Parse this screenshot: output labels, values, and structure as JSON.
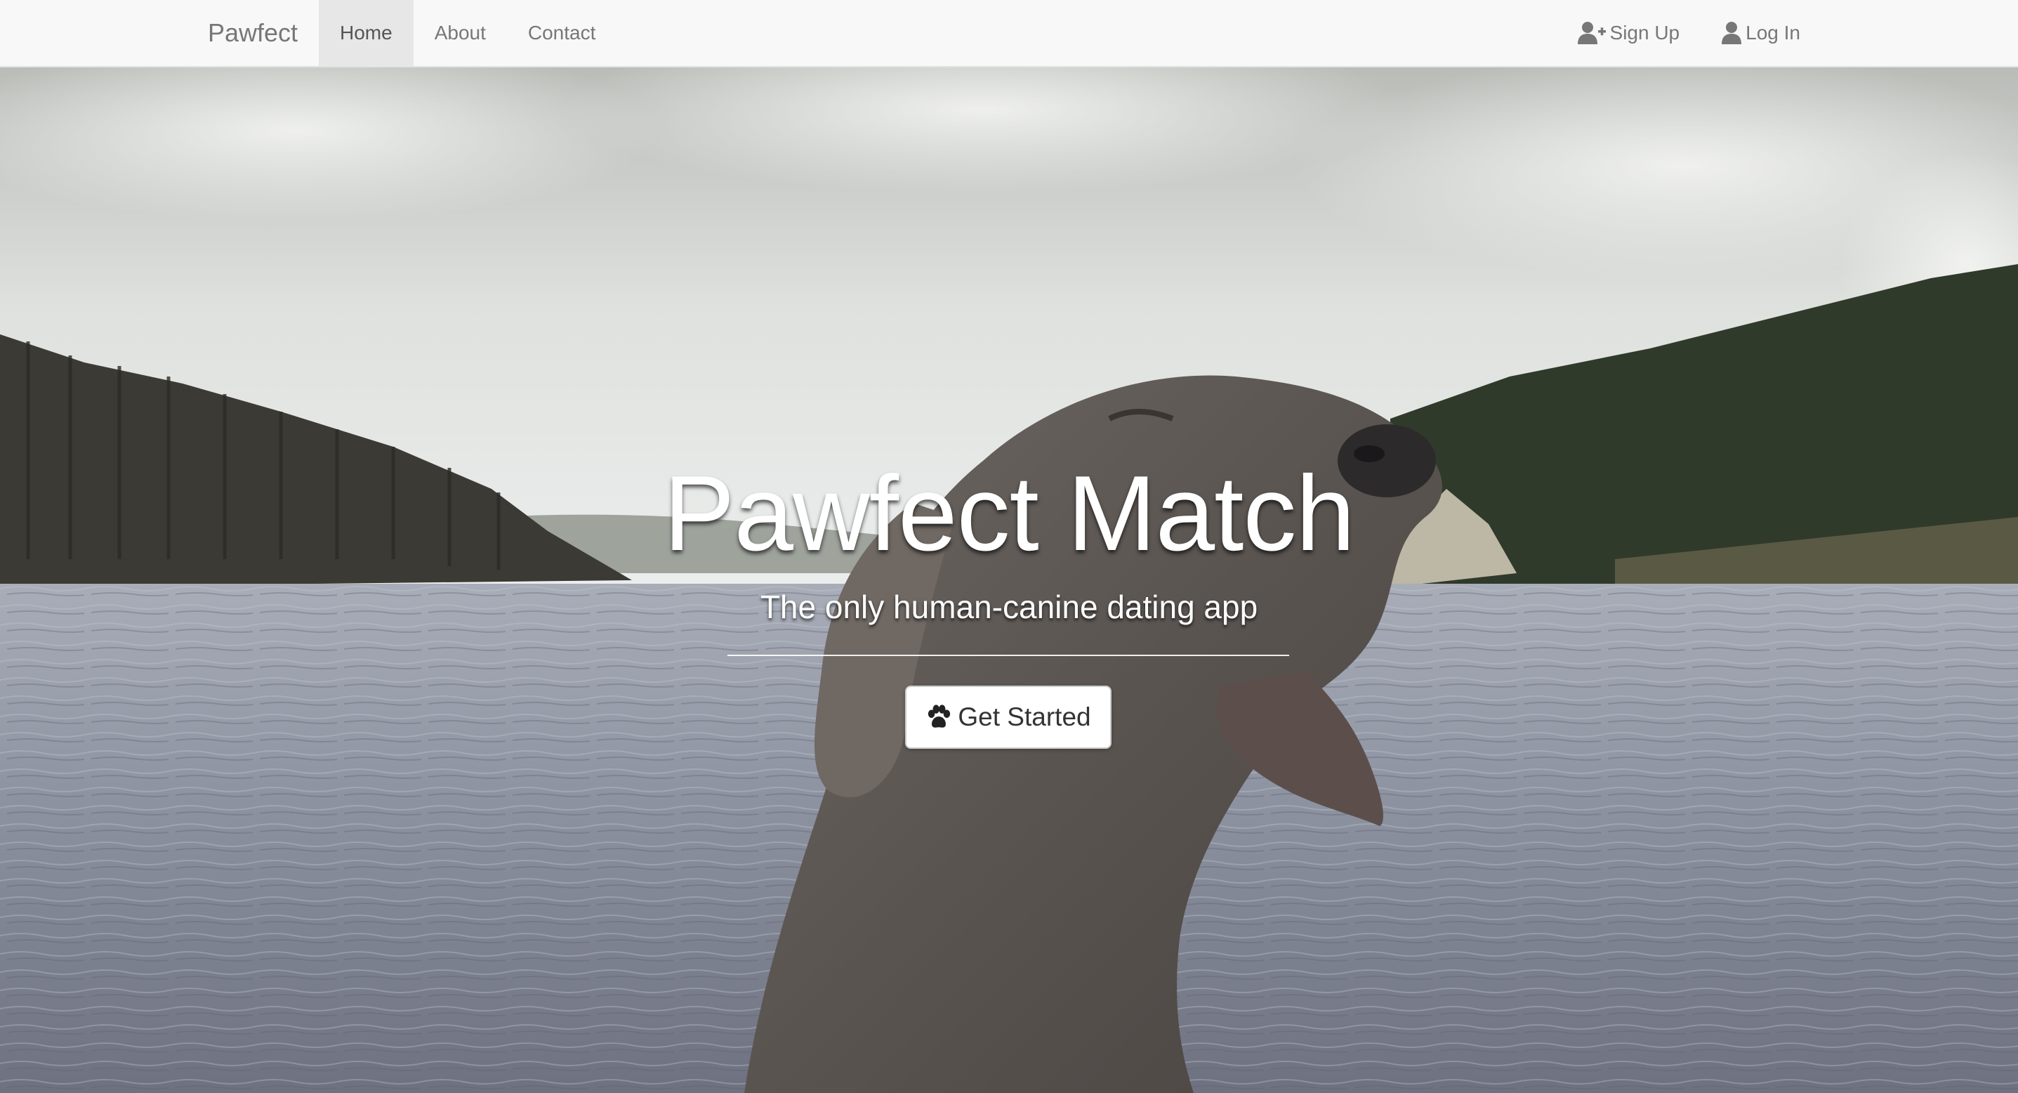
{
  "navbar": {
    "brand": "Pawfect",
    "links": [
      {
        "label": "Home",
        "active": true
      },
      {
        "label": "About",
        "active": false
      },
      {
        "label": "Contact",
        "active": false
      }
    ],
    "right_links": [
      {
        "label": "Sign Up",
        "icon": "user-plus-icon"
      },
      {
        "label": "Log In",
        "icon": "user-icon"
      }
    ]
  },
  "hero": {
    "title": "Pawfect Match",
    "subtitle": "The only human-canine dating app",
    "cta_label": "Get Started",
    "cta_icon": "paw-icon"
  },
  "colors": {
    "navbar_bg": "#f8f8f8",
    "nav_text": "#777777",
    "nav_active_bg": "#e7e7e7",
    "hero_text": "#ffffff",
    "button_bg": "#ffffff"
  }
}
